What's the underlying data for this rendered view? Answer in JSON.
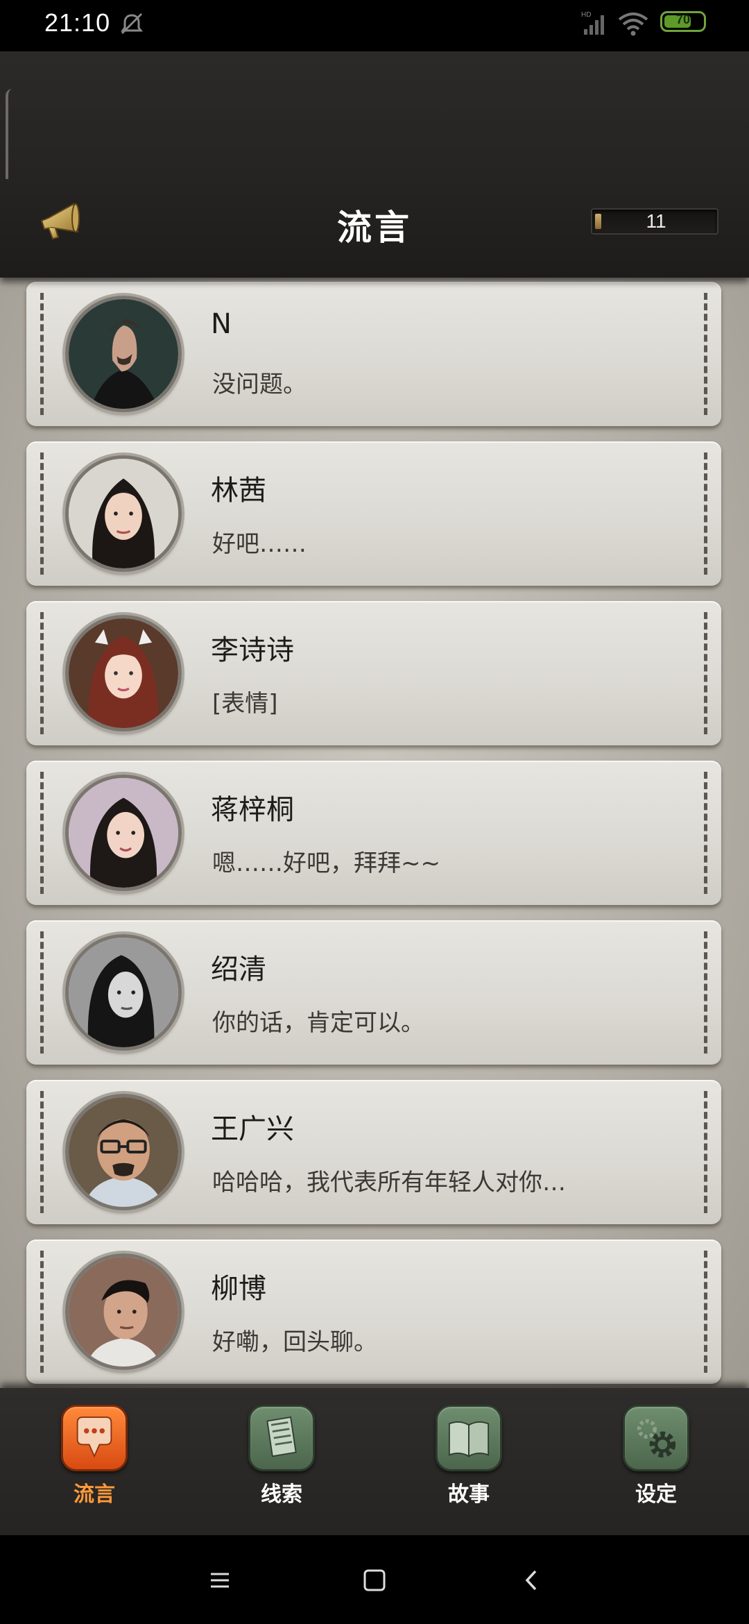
{
  "status_bar": {
    "time": "21:10",
    "battery": "70",
    "battery_level": 0.7,
    "icons": [
      "alarm-off-icon",
      "hd-signal-icon",
      "wifi-icon",
      "battery-icon"
    ]
  },
  "header": {
    "title": "流言",
    "counter": "11",
    "icon": "horn-icon"
  },
  "contacts": [
    {
      "name": "N",
      "message": "没问题。",
      "avatar": "avatar-n"
    },
    {
      "name": "林茜",
      "message": "好吧……",
      "avatar": "avatar-lin-qian"
    },
    {
      "name": "李诗诗",
      "message": "[表情]",
      "avatar": "avatar-li-shishi"
    },
    {
      "name": "蒋梓桐",
      "message": "嗯……好吧，拜拜~~",
      "avatar": "avatar-jiang-zitong"
    },
    {
      "name": "绍清",
      "message": "你的话，肯定可以。",
      "avatar": "avatar-shao-qing"
    },
    {
      "name": "王广兴",
      "message": "哈哈哈，我代表所有年轻人对你…",
      "avatar": "avatar-wang-guangxing"
    },
    {
      "name": "柳博",
      "message": "好嘞，回头聊。",
      "avatar": "avatar-liu-bo"
    }
  ],
  "bottom_nav": [
    {
      "label": "流言",
      "icon": "chat-bubble-icon",
      "active": true
    },
    {
      "label": "线索",
      "icon": "documents-icon",
      "active": false
    },
    {
      "label": "故事",
      "icon": "book-icon",
      "active": false
    },
    {
      "label": "设定",
      "icon": "gear-icon",
      "active": false
    }
  ],
  "system_nav": [
    "menu-icon",
    "home-icon",
    "back-icon"
  ],
  "colors": {
    "active_tab": "#e8621c",
    "inactive_tab": "#5d7a5e",
    "header_bg": "#262423",
    "card_bg": "#e2e0da"
  }
}
